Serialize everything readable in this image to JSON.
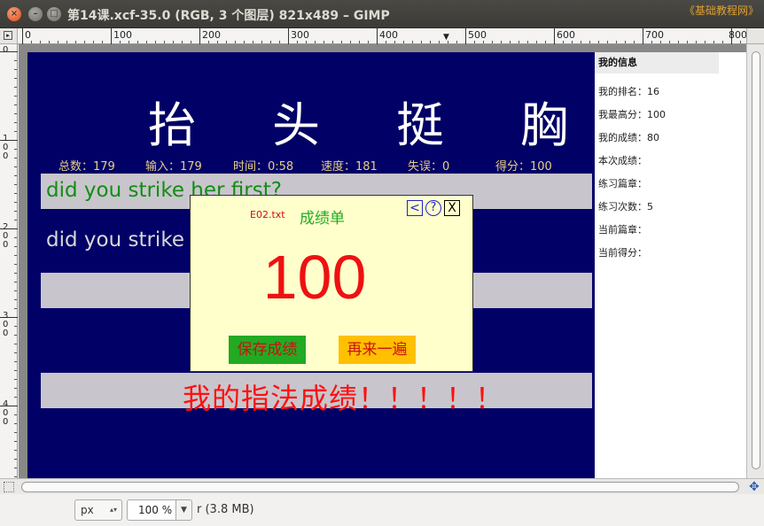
{
  "window": {
    "title": "第14课.xcf-35.0 (RGB, 3 个图层) 821x489 – GIMP",
    "watermark": "《基础教程网》",
    "close_glyph": "×",
    "minimize_glyph": "–",
    "maximize_glyph": "□"
  },
  "rulers": {
    "corner_glyph": "▸",
    "horizontal_labels": [
      "0",
      "100",
      "200",
      "300",
      "400",
      "500",
      "600",
      "700",
      "800"
    ],
    "vertical_labels": [
      "0",
      "100",
      "200",
      "300",
      "400"
    ],
    "pointer_glyph": "▼"
  },
  "game": {
    "lesson_title": "抬头挺胸",
    "stats": {
      "total": "总数：179",
      "input": "输入：179",
      "time": "时间：0:58",
      "speed": "速度：181",
      "errors": "失误：0",
      "score": "得分：100"
    },
    "target_text": "did you strike her first?",
    "typed_text": "did you strike h",
    "result_banner": "我的指法成绩！！！！！"
  },
  "dialog": {
    "file_name": "E02.txt",
    "title": "成绩单",
    "back_label": "<",
    "help_label": "?",
    "close_label": "X",
    "score": "100",
    "save_button": "保存成绩",
    "again_button": "再来一遍"
  },
  "info_panel": {
    "heading": "我的信息",
    "rows": [
      "我的排名：16",
      "我最高分：100",
      "我的成绩：80",
      "本次成绩：",
      "练习篇章：",
      "练习次数：5",
      "当前篇章：",
      "当前得分："
    ]
  },
  "statusbar": {
    "unit": "px",
    "unit_arrows": "▴▾",
    "zoom": "100 %",
    "zoom_arrow": "▼",
    "status_text": "r (3.8 MB)"
  },
  "scroll": {
    "nav_glyph": "✥"
  }
}
